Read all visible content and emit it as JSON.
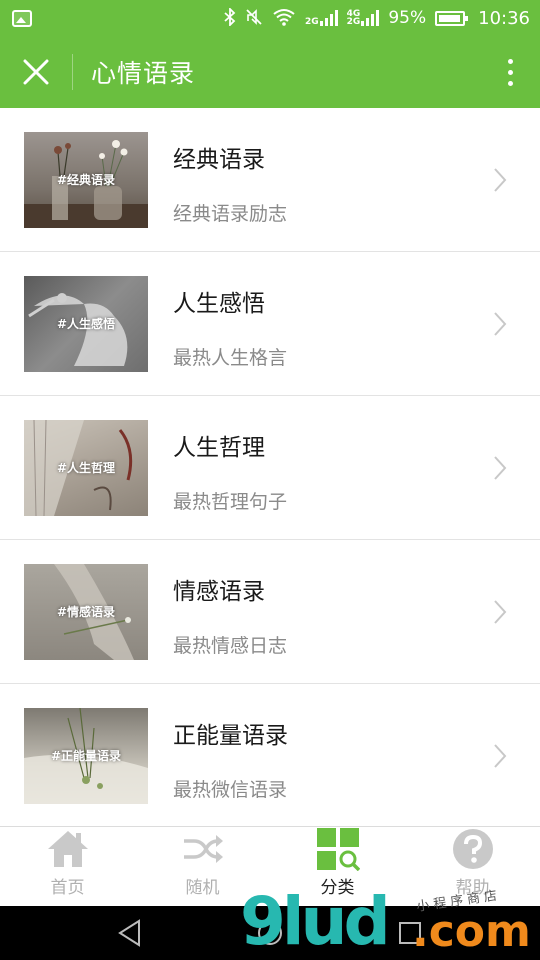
{
  "status_bar": {
    "network_4g": "4G",
    "network_2g_a": "2G",
    "network_2g_b": "2G",
    "battery": "95%",
    "time": "10:36",
    "battery_level": 0.95
  },
  "app_bar": {
    "title": "心情语录",
    "close_icon": "close-icon",
    "more_icon": "more-vertical-icon"
  },
  "colors": {
    "primary": "#6abf3f",
    "title_text": "#1a1a1a",
    "subtitle_text": "#8a8a8a",
    "tab_inactive": "#b0b0b0"
  },
  "items": [
    {
      "tag": "#经典语录",
      "title": "经典语录",
      "subtitle": "经典语录励志"
    },
    {
      "tag": "#人生感悟",
      "title": "人生感悟",
      "subtitle": "最热人生格言"
    },
    {
      "tag": "#人生哲理",
      "title": "人生哲理",
      "subtitle": "最热哲理句子"
    },
    {
      "tag": "#情感语录",
      "title": "情感语录",
      "subtitle": "最热情感日志"
    },
    {
      "tag": "#正能量语录",
      "title": "正能量语录",
      "subtitle": "最热微信语录"
    }
  ],
  "tabs": [
    {
      "label": "首页",
      "icon": "home-icon"
    },
    {
      "label": "随机",
      "icon": "shuffle-icon"
    },
    {
      "label": "分类",
      "icon": "category-search-icon"
    },
    {
      "label": "帮助",
      "icon": "help-icon"
    }
  ],
  "watermark": {
    "brand": "9lud",
    "domain": ".com",
    "tagline": "小程序商店"
  }
}
